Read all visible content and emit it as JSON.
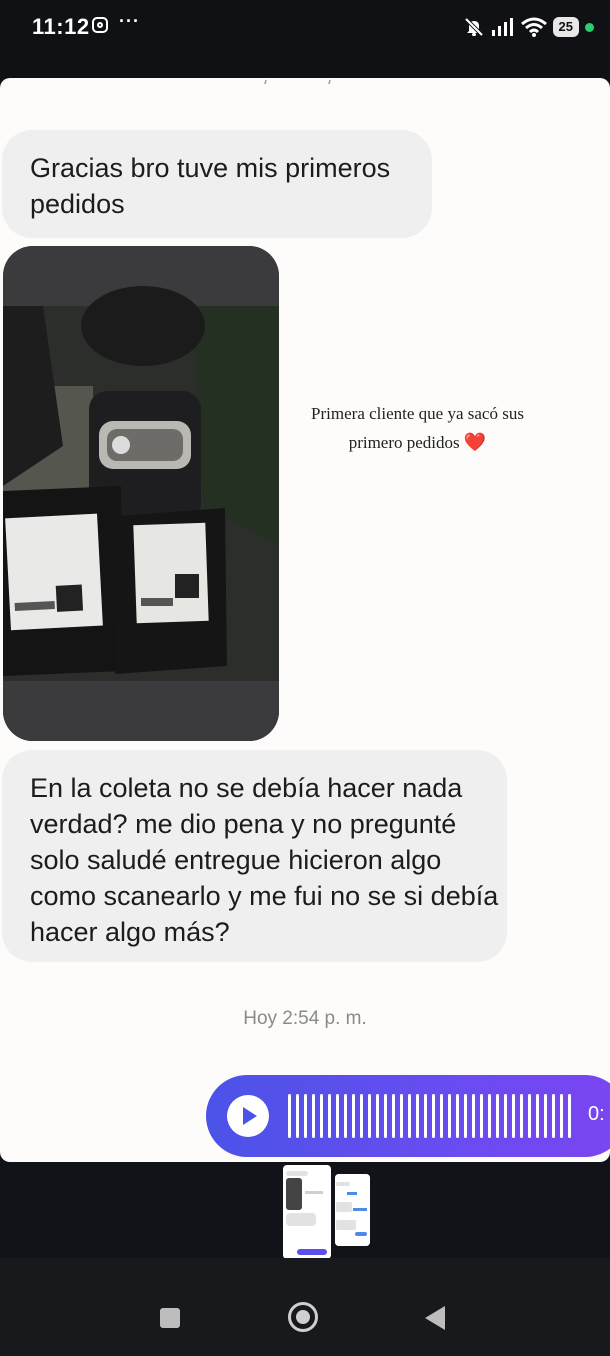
{
  "status_bar": {
    "time": "11:12",
    "more": "···",
    "battery": "25",
    "icons": [
      "instagram-icon",
      "mute-icon",
      "signal-icon",
      "wifi-icon",
      "battery-icon"
    ],
    "active_dot_color": "#2ecc71"
  },
  "chat": {
    "message_1": "Gracias bro tuve mis primeros pedidos",
    "image_caption": "Primera cliente que ya sacó sus primero pedidos",
    "caption_emoji": "❤️",
    "message_2": "En la coleta no se debía hacer nada verdad? me dio pena y no pregunté solo saludé entregue hicieron algo como scanearlo y me fui no se si debía hacer algo más?",
    "timestamp": "Hoy 2:54 p. m.",
    "audio": {
      "duration": "0:",
      "accent": "#4b53e8"
    }
  },
  "navigation": {
    "buttons": [
      "recents-button",
      "home-button",
      "back-button"
    ]
  }
}
